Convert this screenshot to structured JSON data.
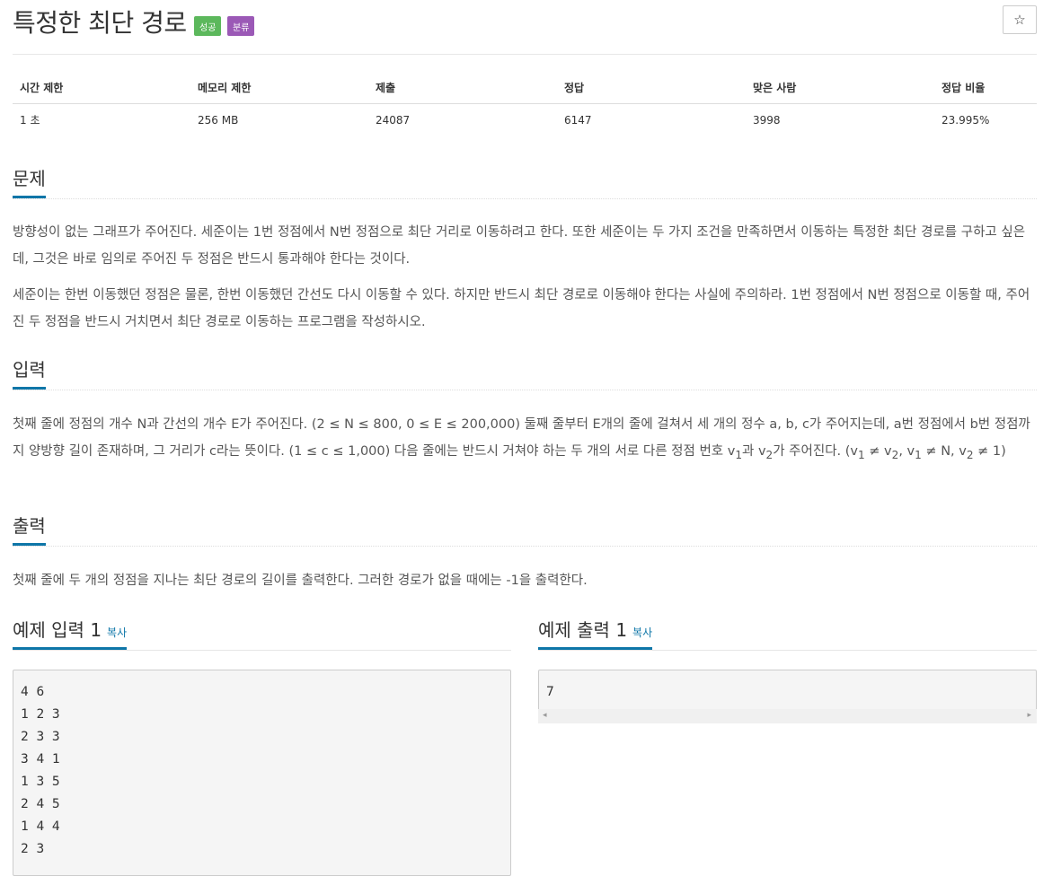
{
  "problem": {
    "title": "특정한 최단 경로",
    "badges": [
      {
        "text": "성공",
        "color": "#5cb85c"
      },
      {
        "text": "분류",
        "color": "#9b59b6"
      }
    ],
    "star": "☆"
  },
  "info_table": {
    "headers": [
      "시간 제한",
      "메모리 제한",
      "제출",
      "정답",
      "맞은 사람",
      "정답 비율"
    ],
    "values": [
      "1 초",
      "256 MB",
      "24087",
      "6147",
      "3998",
      "23.995%"
    ]
  },
  "sections": {
    "description": {
      "heading": "문제",
      "p1": "방향성이 없는 그래프가 주어진다. 세준이는 1번 정점에서 N번 정점으로 최단 거리로 이동하려고 한다. 또한 세준이는 두 가지 조건을 만족하면서 이동하는 특정한 최단 경로를 구하고 싶은데, 그것은 바로 임의로 주어진 두 정점은 반드시 통과해야 한다는 것이다.",
      "p2": "세준이는 한번 이동했던 정점은 물론, 한번 이동했던 간선도 다시 이동할 수 있다. 하지만 반드시 최단 경로로 이동해야 한다는 사실에 주의하라. 1번 정점에서 N번 정점으로 이동할 때, 주어진 두 정점을 반드시 거치면서 최단 경로로 이동하는 프로그램을 작성하시오."
    },
    "input": {
      "heading": "입력",
      "part1": "첫째 줄에 정점의 개수 N과 간선의 개수 E가 주어진다. (2 ≤ N ≤ 800, 0 ≤ E ≤ 200,000) 둘째 줄부터 E개의 줄에 걸쳐서 세 개의 정수 a, b, c가 주어지는데, a번 정점에서 b번 정점까지 양방향 길이 존재하며, 그 거리가 c라는 뜻이다. (1 ≤ c ≤ 1,000) 다음 줄에는 반드시 거쳐야 하는 두 개의 서로 다른 정점 번호 v",
      "sub1": "1",
      "part2": "과 v",
      "sub2": "2",
      "part3": "가 주어진다. (v",
      "sub3": "1",
      "part4": " ≠ v",
      "sub4": "2",
      "part5": ", v",
      "sub5": "1",
      "part6": " ≠ N, v",
      "sub6": "2",
      "part7": " ≠ 1)"
    },
    "output": {
      "heading": "출력",
      "text": "첫째 줄에 두 개의 정점을 지나는 최단 경로의 길이를 출력한다. 그러한 경로가 없을 때에는 -1을 출력한다."
    }
  },
  "samples": {
    "input": {
      "heading": "예제 입력 1",
      "copy": "복사",
      "content": "4 6\n1 2 3\n2 3 3\n3 4 1\n1 3 5\n2 4 5\n1 4 4\n2 3"
    },
    "output": {
      "heading": "예제 출력 1",
      "copy": "복사",
      "content": "7"
    },
    "scroll_left": "◂",
    "scroll_right": "▸"
  }
}
